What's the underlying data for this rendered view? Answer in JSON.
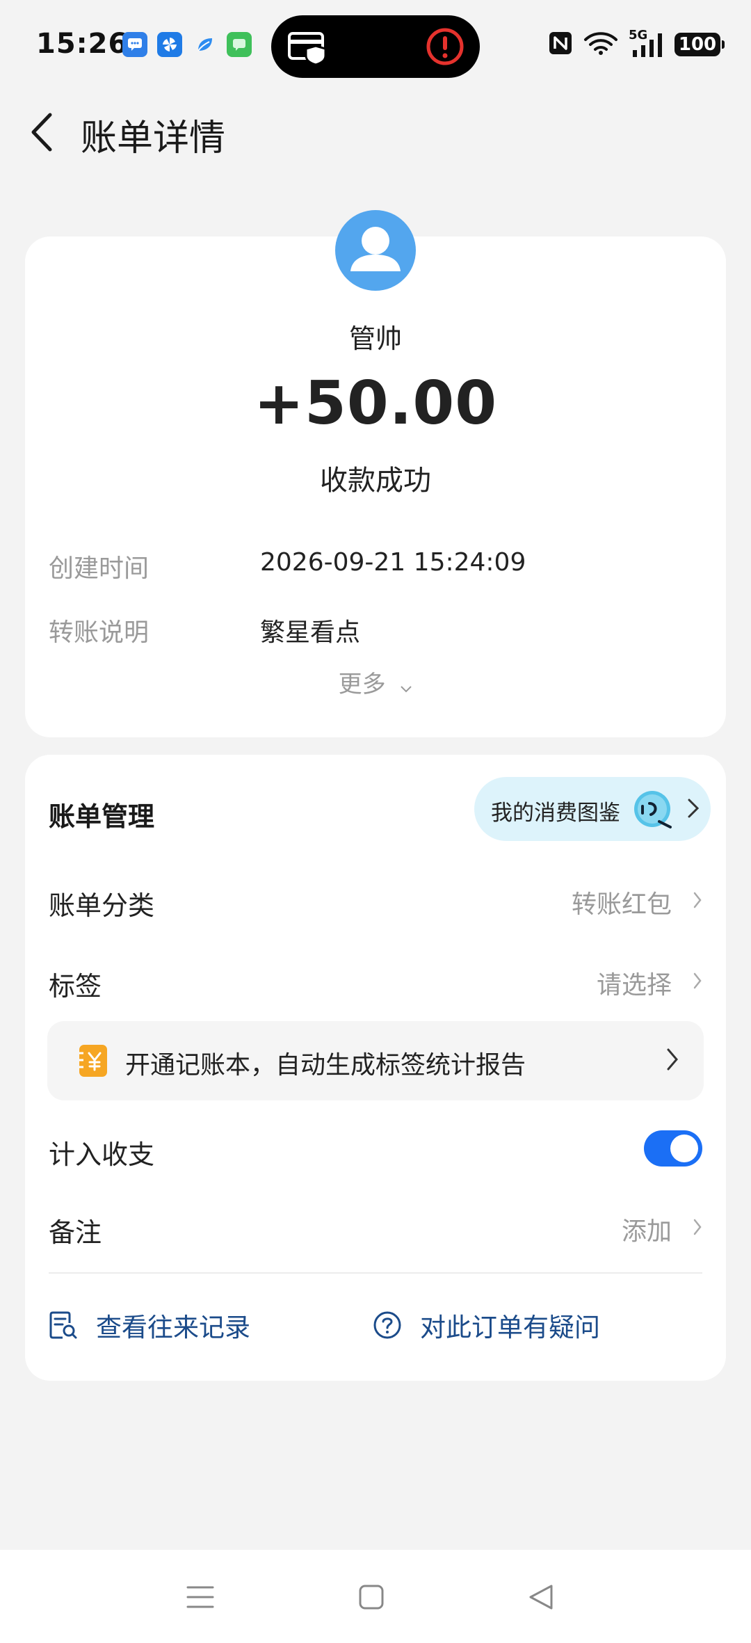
{
  "status_bar": {
    "time": "15:26",
    "network": "5G",
    "battery": "100",
    "notification_icons": [
      "message-icon",
      "pinwheel-icon",
      "browser-icon",
      "chat-icon"
    ]
  },
  "header": {
    "title": "账单详情"
  },
  "transaction": {
    "payer": "管帅",
    "amount": "+50.00",
    "status": "收款成功",
    "details": [
      {
        "label": "创建时间",
        "value": "2026-09-21 15:24:09"
      },
      {
        "label": "转账说明",
        "value": "繁星看点"
      }
    ],
    "more_label": "更多"
  },
  "management": {
    "title": "账单管理",
    "consumption_pill": "我的消费图鉴",
    "category": {
      "label": "账单分类",
      "value": "转账红包"
    },
    "tags": {
      "label": "标签",
      "value": "请选择"
    },
    "promo": "开通记账本，自动生成标签统计报告",
    "income": {
      "label": "计入收支",
      "enabled": true
    },
    "remark": {
      "label": "备注",
      "value": "添加"
    },
    "history_link": "查看往来记录",
    "question_link": "对此订单有疑问"
  },
  "colors": {
    "accent": "#1b6ff5",
    "link": "#1b4b8a",
    "avatar": "#53a6ee",
    "pill_bg": "#ddf3fb",
    "page_bg": "#f3f3f3"
  }
}
